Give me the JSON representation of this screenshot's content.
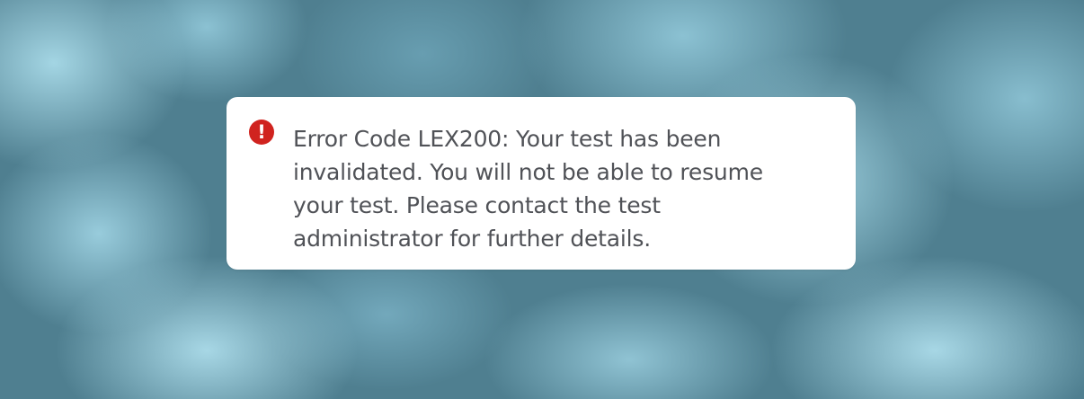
{
  "background": {
    "theme": "cloudy-sky"
  },
  "alert": {
    "icon": "exclamation-circle-icon",
    "icon_color": "#d0231f",
    "icon_glyph": "!",
    "message": "Error Code LEX200: Your test has been invalidated. You will not be able to resume your test. Please contact the test administrator for further details."
  }
}
